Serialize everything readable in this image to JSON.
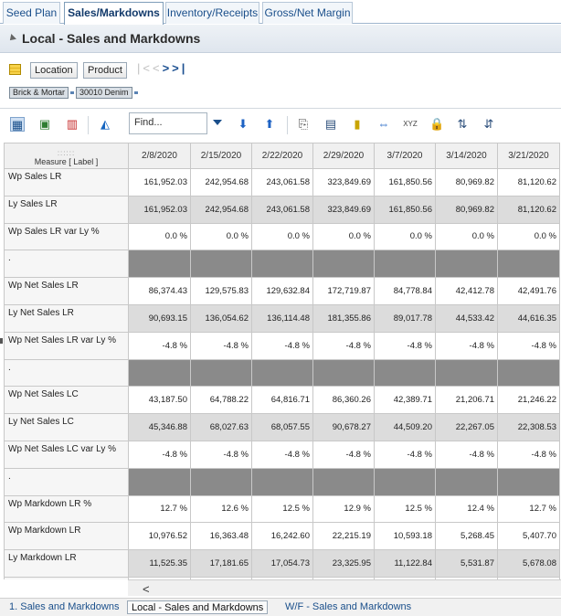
{
  "tabs": [
    "Seed Plan",
    "Sales/Markdowns",
    "Inventory/Receipts",
    "Gross/Net Margin"
  ],
  "panel_title": "Local - Sales and Markdowns",
  "dims": {
    "location": "Location",
    "product": "Product"
  },
  "crumbs": [
    "Brick & Mortar",
    "30010 Denim"
  ],
  "find_placeholder": "Find...",
  "grid": {
    "corner_label": "Measure [ Label ]",
    "dates": [
      "2/8/2020",
      "2/15/2020",
      "2/22/2020",
      "2/29/2020",
      "3/7/2020",
      "3/14/2020",
      "3/21/2020"
    ],
    "rows": [
      {
        "label": "Wp Sales LR",
        "style": "white",
        "values": [
          "161,952.03",
          "242,954.68",
          "243,061.58",
          "323,849.69",
          "161,850.56",
          "80,969.82",
          "81,120.62"
        ]
      },
      {
        "label": "Ly Sales LR",
        "style": "shade",
        "values": [
          "161,952.03",
          "242,954.68",
          "243,061.58",
          "323,849.69",
          "161,850.56",
          "80,969.82",
          "81,120.62"
        ]
      },
      {
        "label": "Wp Sales LR var Ly %",
        "style": "white",
        "values": [
          "0.0 %",
          "0.0 %",
          "0.0 %",
          "0.0 %",
          "0.0 %",
          "0.0 %",
          "0.0 %"
        ]
      },
      {
        "label": ".",
        "style": "sep",
        "values": [
          "",
          "",
          "",
          "",
          "",
          "",
          ""
        ]
      },
      {
        "label": "Wp Net Sales LR",
        "style": "white",
        "values": [
          "86,374.43",
          "129,575.83",
          "129,632.84",
          "172,719.87",
          "84,778.84",
          "42,412.78",
          "42,491.76"
        ]
      },
      {
        "label": "Ly Net Sales LR",
        "style": "shade",
        "values": [
          "90,693.15",
          "136,054.62",
          "136,114.48",
          "181,355.86",
          "89,017.78",
          "44,533.42",
          "44,616.35"
        ]
      },
      {
        "label": "Wp Net Sales LR var Ly %",
        "style": "white",
        "values": [
          "-4.8 %",
          "-4.8 %",
          "-4.8 %",
          "-4.8 %",
          "-4.8 %",
          "-4.8 %",
          "-4.8 %"
        ]
      },
      {
        "label": ".",
        "style": "sep",
        "values": [
          "",
          "",
          "",
          "",
          "",
          "",
          ""
        ]
      },
      {
        "label": "Wp Net Sales LC",
        "style": "white",
        "values": [
          "43,187.50",
          "64,788.22",
          "64,816.71",
          "86,360.26",
          "42,389.71",
          "21,206.71",
          "21,246.22"
        ]
      },
      {
        "label": "Ly Net Sales LC",
        "style": "shade",
        "values": [
          "45,346.88",
          "68,027.63",
          "68,057.55",
          "90,678.27",
          "44,509.20",
          "22,267.05",
          "22,308.53"
        ]
      },
      {
        "label": "Wp Net Sales LC var Ly %",
        "style": "white",
        "values": [
          "-4.8 %",
          "-4.8 %",
          "-4.8 %",
          "-4.8 %",
          "-4.8 %",
          "-4.8 %",
          "-4.8 %"
        ]
      },
      {
        "label": ".",
        "style": "sep",
        "values": [
          "",
          "",
          "",
          "",
          "",
          "",
          ""
        ]
      },
      {
        "label": "Wp Markdown LR %",
        "style": "white",
        "values": [
          "12.7 %",
          "12.6 %",
          "12.5 %",
          "12.9 %",
          "12.5 %",
          "12.4 %",
          "12.7 %"
        ]
      },
      {
        "label": "Wp Markdown LR",
        "style": "white",
        "values": [
          "10,976.52",
          "16,363.48",
          "16,242.60",
          "22,215.19",
          "10,593.18",
          "5,268.45",
          "5,407.70"
        ]
      },
      {
        "label": "Ly Markdown LR",
        "style": "shade",
        "values": [
          "11,525.35",
          "17,181.65",
          "17,054.73",
          "23,325.95",
          "11,122.84",
          "5,531.87",
          "5,678.08"
        ]
      },
      {
        "label": "",
        "style": "white",
        "values": [
          "",
          "",
          "",
          "",
          "",
          "",
          ""
        ]
      }
    ]
  },
  "bottom_tabs": [
    "1. Sales and Markdowns",
    "Local - Sales and Markdowns",
    "W/F - Sales and Markdowns"
  ],
  "colors": {
    "accent": "#1a4f8b",
    "separator_row": "#8a8a8a",
    "shaded_row": "#dcdcdc"
  }
}
